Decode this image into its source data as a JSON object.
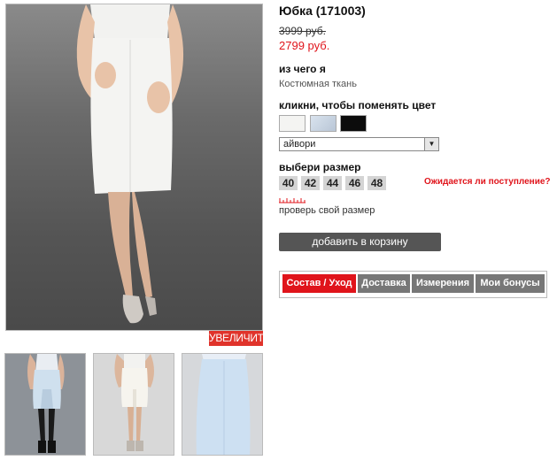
{
  "product": {
    "title": "Юбка (171003)",
    "old_price": "3999 руб.",
    "new_price": "2799 руб."
  },
  "material": {
    "label": "из чего я",
    "value": "Костюмная ткань"
  },
  "colors": {
    "label": "кликни, чтобы поменять цвет",
    "selected": "айвори",
    "swatches": [
      "#f4f4f2",
      "#c9d5e2",
      "#0c0c0c"
    ]
  },
  "sizes": {
    "label": "выбери размер",
    "items": [
      "40",
      "42",
      "44",
      "46",
      "48"
    ],
    "await_link": "Ожидается ли поступление?",
    "check_size": "проверь свой размер"
  },
  "actions": {
    "add_to_cart": "добавить в корзину",
    "zoom": "УВЕЛИЧИТЬ"
  },
  "tabs": [
    {
      "label": "Состав / Уход",
      "active": true
    },
    {
      "label": "Доставка",
      "active": false
    },
    {
      "label": "Измерения",
      "active": false
    },
    {
      "label": "Мои бонусы",
      "active": false
    }
  ],
  "colors_theme": {
    "accent": "#e0141b",
    "button": "#555555",
    "tab_inactive": "#777777"
  }
}
